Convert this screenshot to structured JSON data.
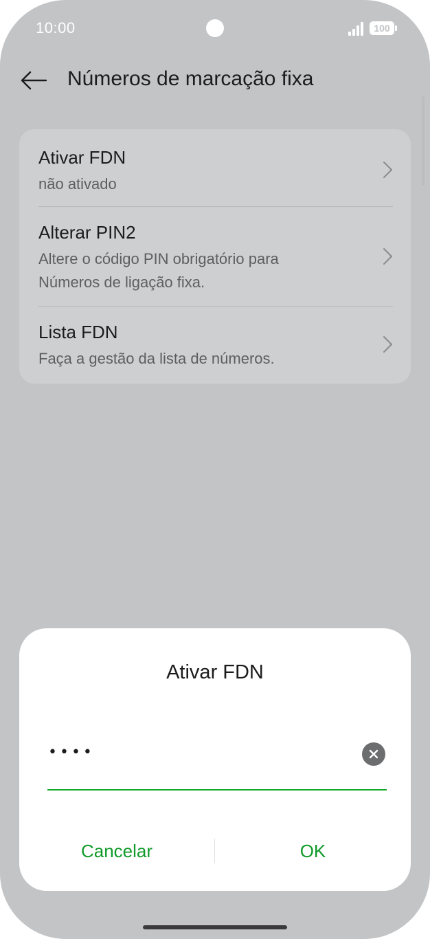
{
  "status_bar": {
    "time": "10:00",
    "battery": "100",
    "icons": [
      "camera-cutout",
      "signal-icon",
      "battery-icon"
    ]
  },
  "header": {
    "title": "Números de marcação fixa",
    "back_icon": "arrow-left-icon"
  },
  "settings": {
    "items": [
      {
        "title": "Ativar FDN",
        "subtitle": "não ativado",
        "icon": "chevron-right-icon"
      },
      {
        "title": "Alterar PIN2",
        "subtitle": "Altere o código PIN obrigatório para Números de ligação fixa.",
        "icon": "chevron-right-icon"
      },
      {
        "title": "Lista FDN",
        "subtitle": "Faça a gestão da lista de números.",
        "icon": "chevron-right-icon"
      }
    ]
  },
  "dialog": {
    "title": "Ativar FDN",
    "input_value": "••••",
    "clear_icon": "clear-icon",
    "cancel_label": "Cancelar",
    "ok_label": "OK"
  },
  "colors": {
    "accent": "#109a2a",
    "underline": "#15a92e",
    "background_dim": "#c3c4c6",
    "card": "#cecfd0"
  }
}
